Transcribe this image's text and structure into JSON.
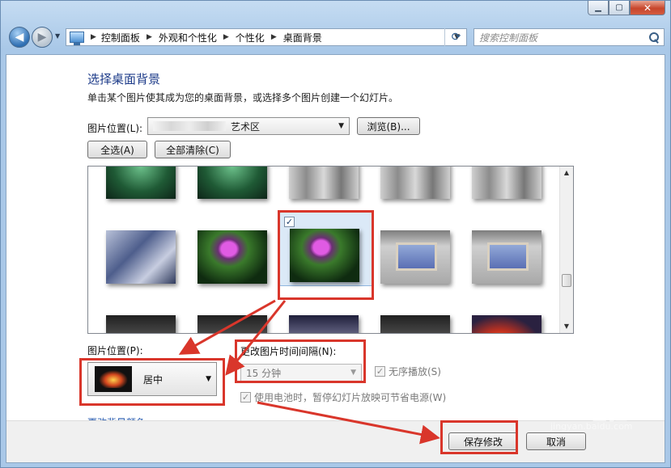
{
  "breadcrumb": [
    "控制面板",
    "外观和个性化",
    "个性化",
    "桌面背景"
  ],
  "search": {
    "placeholder": "搜索控制面板"
  },
  "page": {
    "title": "选择桌面背景",
    "description": "单击某个图片使其成为您的桌面背景，或选择多个图片创建一个幻灯片。"
  },
  "picture_location": {
    "label": "图片位置(L):",
    "value_visible_suffix": "艺术区",
    "browse_label": "浏览(B)..."
  },
  "selection_buttons": {
    "select_all": "全选(A)",
    "clear_all": "全部清除(C)"
  },
  "gallery": {
    "selected_checkmark": "✓"
  },
  "picture_position": {
    "label": "图片位置(P):",
    "value": "居中"
  },
  "interval": {
    "label": "更改图片时间间隔(N):",
    "value": "15 分钟"
  },
  "shuffle": {
    "label": "无序播放(S)",
    "checked": "✓"
  },
  "battery": {
    "label": "使用电池时，暂停幻灯片放映可节省电源(W)",
    "checked": "✓"
  },
  "background_color_link": "更改背景颜色",
  "footer": {
    "save": "保存修改",
    "cancel": "取消"
  },
  "caption": {
    "minimize": "▁",
    "maximize": "▢",
    "close": "✕"
  },
  "watermark": {
    "text": "Baidu经验",
    "sub": "jingyan.baidu.com"
  },
  "colors": {
    "title_blue": "#1e3c8a",
    "highlight_red": "#d9362b"
  }
}
